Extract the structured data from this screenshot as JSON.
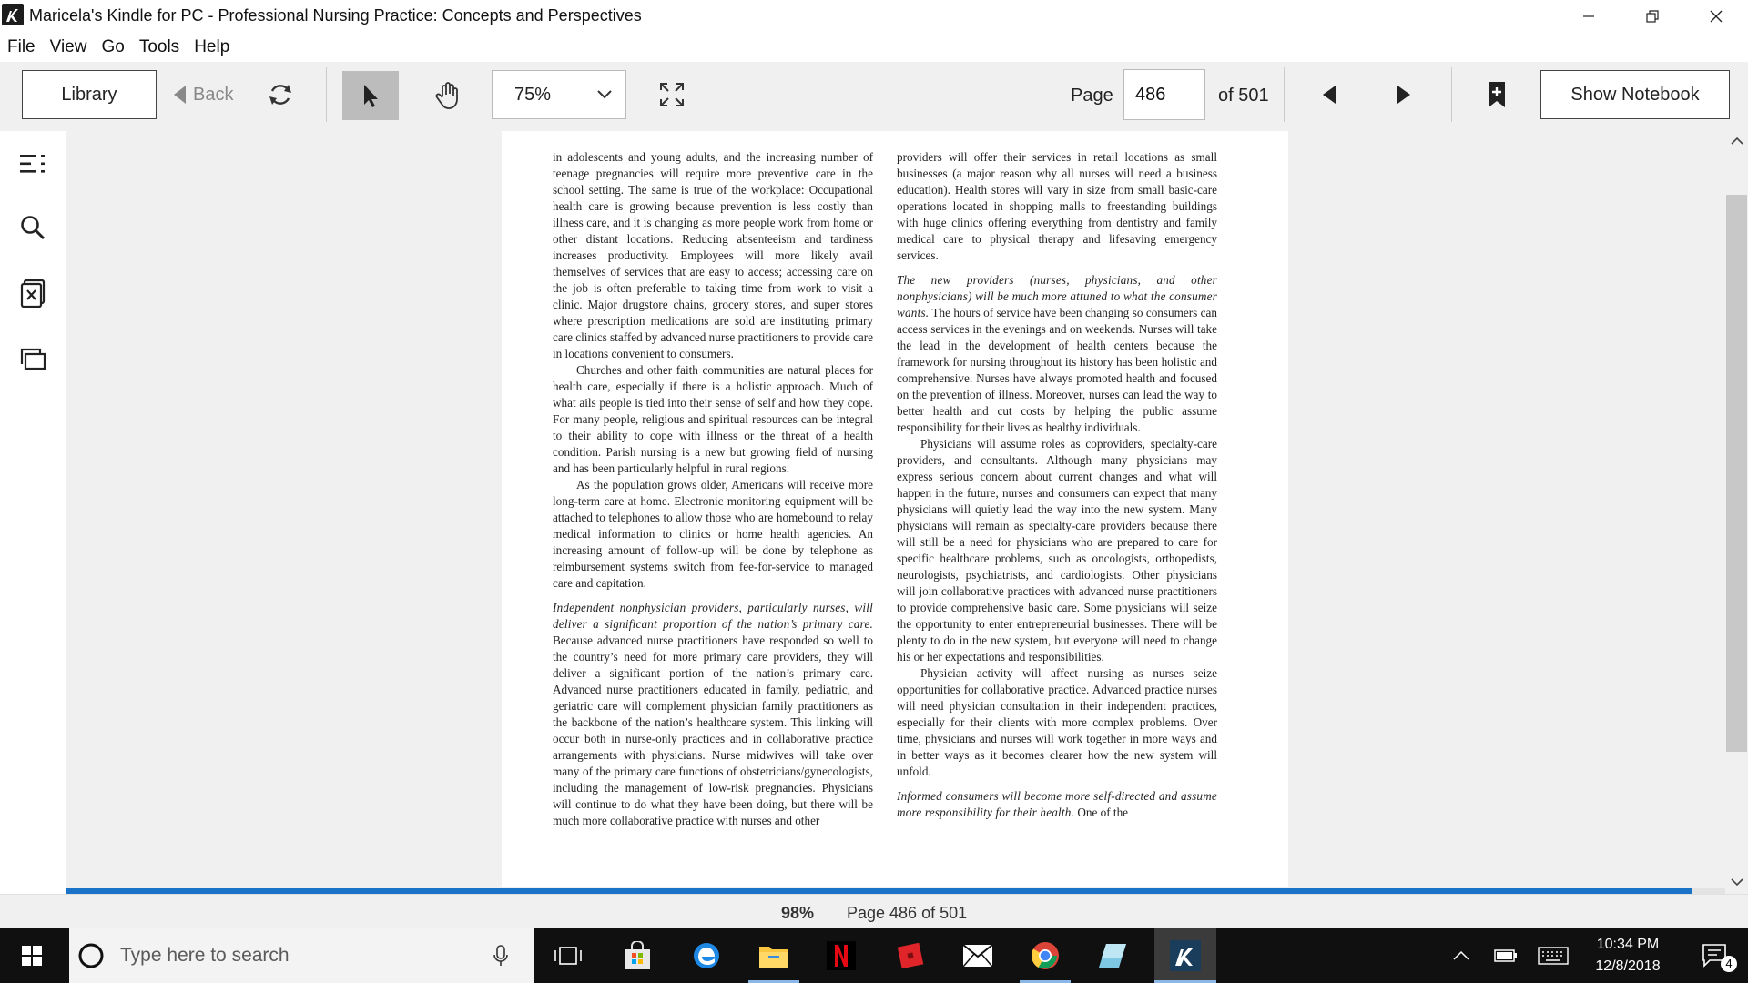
{
  "window": {
    "title": "Maricela's Kindle for PC - Professional Nursing Practice: Concepts and Perspectives"
  },
  "menu": [
    "File",
    "View",
    "Go",
    "Tools",
    "Help"
  ],
  "toolbar": {
    "library_label": "Library",
    "back_label": "Back",
    "zoom_value": "75%",
    "page_label": "Page",
    "page_value": "486",
    "page_of": "of 501",
    "show_notebook_label": "Show Notebook"
  },
  "book": {
    "col1": [
      "in adolescents and young adults, and the increasing number of teenage pregnancies will require more preventive care in the school setting. The same is true of the workplace: Occupational health care is growing because prevention is less costly than illness care, and it is changing as more people work from home or other distant locations. Reducing absenteeism and tardiness increases productivity. Employees will more likely avail themselves of services that are easy to access; accessing care on the job is often preferable to taking time from work to visit a clinic. Major drugstore chains, grocery stores, and super stores where prescription medications are sold are instituting primary care clinics staffed by advanced nurse practitioners to provide care in locations convenient to consumers.",
      "Churches and other faith communities are natural places for health care, especially if there is a holistic approach. Much of what ails people is tied into their sense of self and how they cope. For many people, religious and spiritual resources can be integral to their ability to cope with illness or the threat of a health condition. Parish nursing is a new but growing field of nursing and has been particularly helpful in rural regions.",
      "As the population grows older, Americans will receive more long-term care at home. Electronic monitoring equipment will be attached to telephones to allow those who are homebound to relay medical information to clinics or home health agencies. An increasing amount of follow-up will be done by telephone as reimbursement systems switch from fee-for-service to managed care and capitation.",
      {
        "lead": "Independent nonphysician providers, particularly nurses, will deliver a significant proportion of the nation’s primary care.",
        "text": "Because advanced nurse practitioners have responded so well to the country’s need for more primary care providers, they will deliver a significant portion of the nation’s primary care. Advanced nurse practitioners educated in family, pediatric, and geriatric care will complement physician family practitioners as the backbone of the nation’s healthcare system. This linking will occur both in nurse-only practices and in collaborative practice arrangements with physicians. Nurse midwives will take over many of the primary care functions of obstetricians/gynecologists, including the management of low-risk pregnancies. Physicians will continue to do what they have been doing, but there will be much more collaborative practice with nurses and other"
      }
    ],
    "col2": [
      "providers will offer their services in retail locations as small businesses (a major reason why all nurses will need a business education). Health stores will vary in size from small basic-care operations located in shopping malls to freestanding buildings with huge clinics offering everything from dentistry and family medical care to physical therapy and lifesaving emergency services.",
      {
        "lead": "The new providers (nurses, physicians, and other nonphysicians) will be much more attuned to what the consumer wants.",
        "text": "The hours of service have been changing so consumers can access services in the evenings and on weekends. Nurses will take the lead in the development of health centers because the framework for nursing throughout its history has been holistic and comprehensive. Nurses have always promoted health and focused on the prevention of illness. Moreover, nurses can lead the way to better health and cut costs by helping the public assume responsibility for their lives as healthy individuals."
      },
      "Physicians will assume roles as coproviders, specialty-care providers, and consultants. Although many physicians may express serious concern about current changes and what will happen in the future, nurses and consumers can expect that many physicians will quietly lead the way into the new system. Many physicians will remain as specialty-care providers because there will still be a need for physicians who are prepared to care for specific healthcare problems, such as oncologists, orthopedists, neurologists, psychiatrists, and cardiologists. Other physicians will join collaborative practices with advanced nurse practitioners to provide comprehensive basic care. Some physicians will seize the opportunity to enter entrepreneurial businesses. There will be plenty to do in the new system, but everyone will need to change his or her expectations and responsibilities.",
      "Physician activity will affect nursing as nurses seize opportunities for collaborative practice. Advanced practice nurses will need physician consultation in their independent practices, especially for their clients with more complex problems. Over time, physicians and nurses will work together in more ways and in better ways as it becomes clearer how the new system will unfold.",
      {
        "lead": "Informed consumers will become more self-directed and assume more responsibility for their health.",
        "text": "One of the"
      }
    ]
  },
  "status": {
    "percent": "98%",
    "page_text": "Page 486 of 501",
    "progress": 0.98
  },
  "taskbar": {
    "search_placeholder": "Type here to search",
    "time": "10:34 PM",
    "date": "12/8/2018",
    "notification_count": "4"
  }
}
